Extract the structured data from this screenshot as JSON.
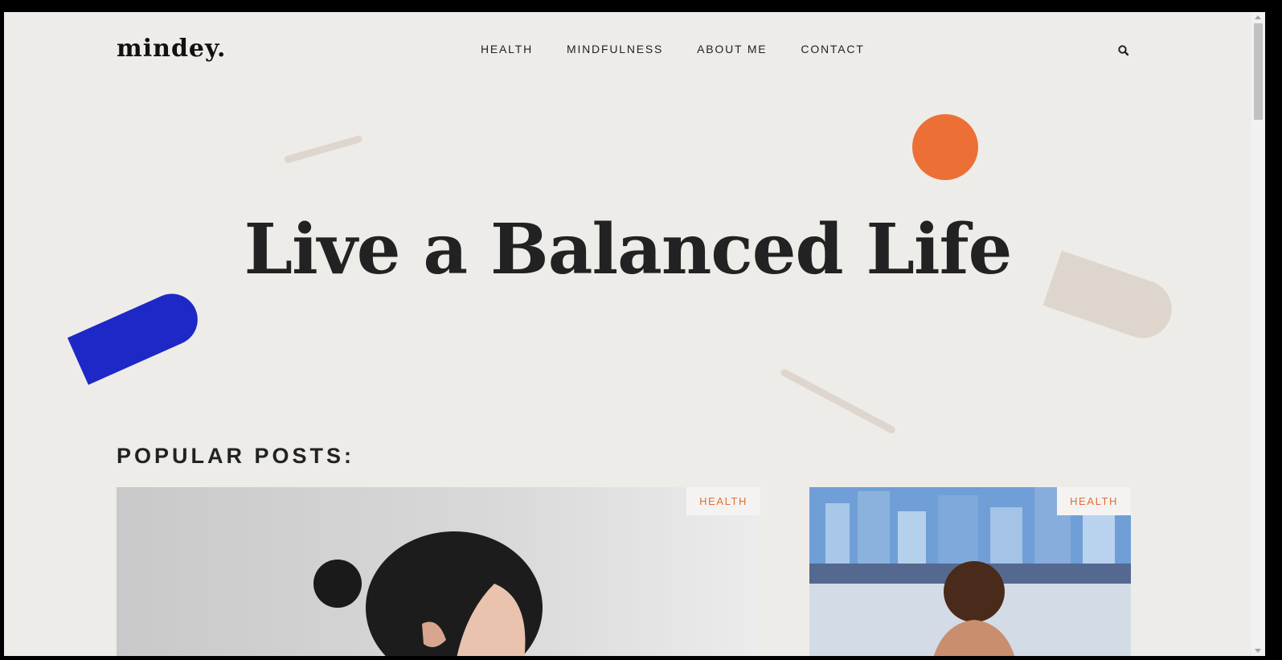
{
  "logo": "mindey.",
  "nav": [
    "HEALTH",
    "MINDFULNESS",
    "ABOUT ME",
    "CONTACT"
  ],
  "hero_title": "Live a Balanced Life",
  "popular_heading": "POPULAR POSTS:",
  "cards": [
    {
      "tag": "HEALTH"
    },
    {
      "tag": "HEALTH"
    }
  ],
  "icons": {
    "search": "search-icon"
  },
  "colors": {
    "background": "#eeece9",
    "accent_orange": "#ec7035",
    "accent_blue": "#1e28c6",
    "beige": "#ded6cc",
    "text": "#222222"
  }
}
